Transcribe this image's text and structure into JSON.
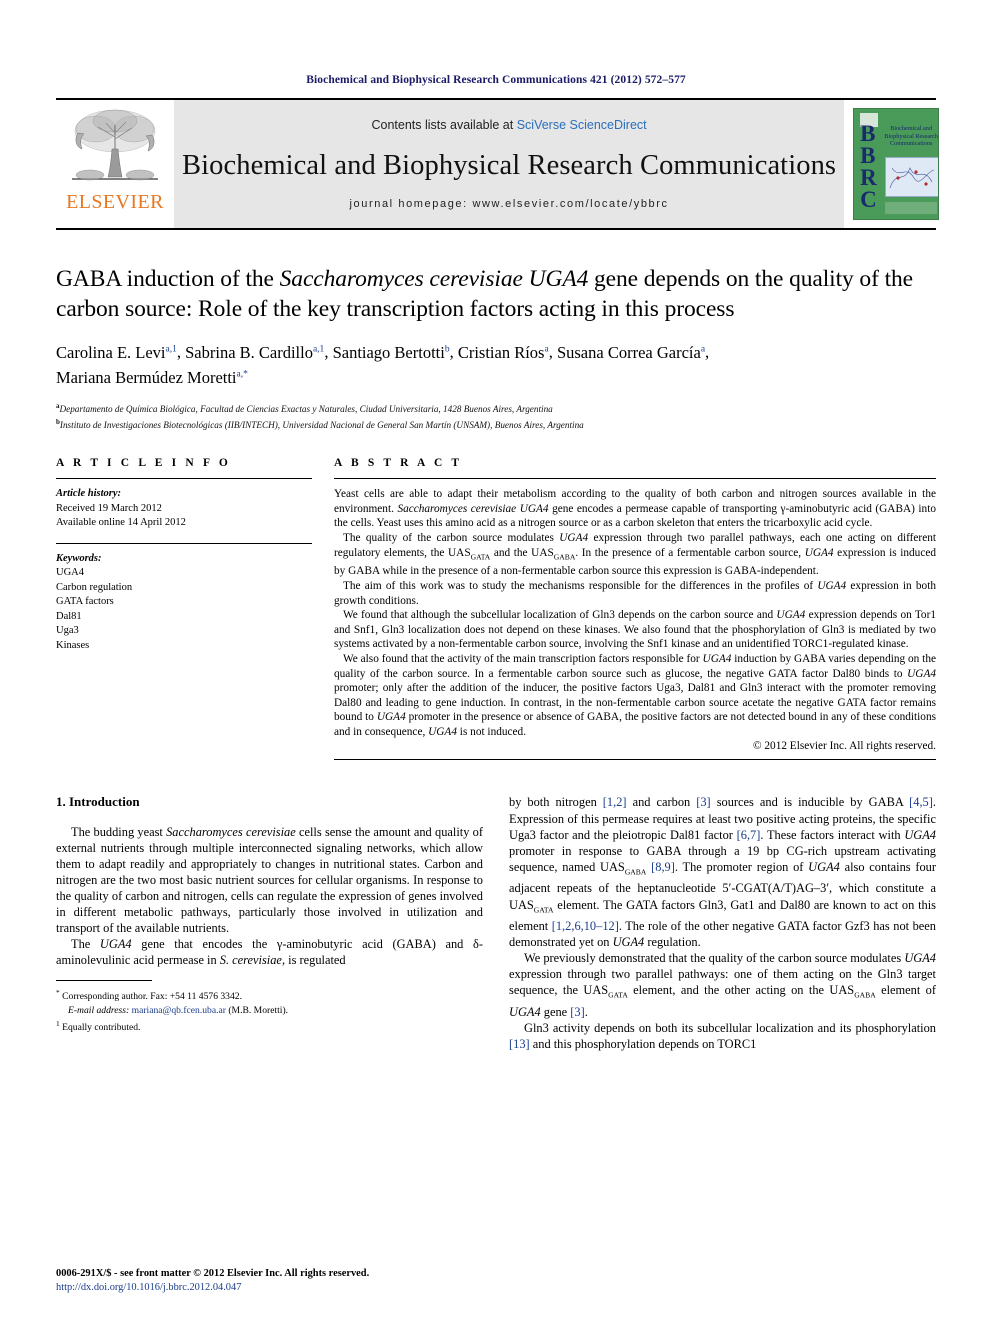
{
  "running_head": "Biochemical and Biophysical Research Communications 421 (2012) 572–577",
  "masthead": {
    "contents_prefix": "Contents lists available at ",
    "contents_link": "SciVerse ScienceDirect",
    "journal_title": "Biochemical and Biophysical Research Communications",
    "homepage": "journal homepage: www.elsevier.com/locate/ybbrc",
    "publisher_wordmark": "ELSEVIER",
    "cover": {
      "letters": "B\nB\nR\nC",
      "title": "Biochemical and Biophysical Research Communications"
    }
  },
  "article": {
    "title_line1": "GABA induction of the ",
    "title_italic1": "Saccharomyces cerevisiae UGA4",
    "title_line2": " gene depends on the quality of the carbon source: Role of the key transcription factors acting in this process",
    "authors": [
      {
        "name": "Carolina E. Levi",
        "marks": "a,1"
      },
      {
        "name": "Sabrina B. Cardillo",
        "marks": "a,1"
      },
      {
        "name": "Santiago Bertotti",
        "marks": "b"
      },
      {
        "name": "Cristian Ríos",
        "marks": "a"
      },
      {
        "name": "Susana Correa García",
        "marks": "a"
      },
      {
        "name": "Mariana Bermúdez Moretti",
        "marks": "a,*"
      }
    ],
    "affiliations": [
      {
        "mark": "a",
        "text": "Departamento de Química Biológica, Facultad de Ciencias Exactas y Naturales, Ciudad Universitaria, 1428 Buenos Aires, Argentina"
      },
      {
        "mark": "b",
        "text": "Instituto de Investigaciones Biotecnológicas (IIB/INTECH), Universidad Nacional de General San Martín (UNSAM), Buenos Aires, Argentina"
      }
    ]
  },
  "article_info": {
    "heading": "A R T I C L E   I N F O",
    "history_label": "Article history:",
    "history_lines": [
      "Received 19 March 2012",
      "Available online 14 April 2012"
    ],
    "keywords_label": "Keywords:",
    "keywords": [
      "UGA4",
      "Carbon regulation",
      "GATA factors",
      "Dal81",
      "Uga3",
      "Kinases"
    ]
  },
  "abstract": {
    "heading": "A B S T R A C T",
    "paragraphs": [
      "Yeast cells are able to adapt their metabolism according to the quality of both carbon and nitrogen sources available in the environment. Saccharomyces cerevisiae UGA4 gene encodes a permease capable of transporting γ-aminobutyric acid (GABA) into the cells. Yeast uses this amino acid as a nitrogen source or as a carbon skeleton that enters the tricarboxylic acid cycle.",
      "The quality of the carbon source modulates UGA4 expression through two parallel pathways, each one acting on different regulatory elements, the UASGATA and the UASGABA. In the presence of a fermentable carbon source, UGA4 expression is induced by GABA while in the presence of a non-fermentable carbon source this expression is GABA-independent.",
      "The aim of this work was to study the mechanisms responsible for the differences in the profiles of UGA4 expression in both growth conditions.",
      "We found that although the subcellular localization of Gln3 depends on the carbon source and UGA4 expression depends on Tor1 and Snf1, Gln3 localization does not depend on these kinases. We also found that the phosphorylation of Gln3 is mediated by two systems activated by a non-fermentable carbon source, involving the Snf1 kinase and an unidentified TORC1-regulated kinase.",
      "We also found that the activity of the main transcription factors responsible for UGA4 induction by GABA varies depending on the quality of the carbon source. In a fermentable carbon source such as glucose, the negative GATA factor Dal80 binds to UGA4 promoter; only after the addition of the inducer, the positive factors Uga3, Dal81 and Gln3 interact with the promoter removing Dal80 and leading to gene induction. In contrast, in the non-fermentable carbon source acetate the negative GATA factor remains bound to UGA4 promoter in the presence or absence of GABA, the positive factors are not detected bound in any of these conditions and in consequence, UGA4 is not induced."
    ],
    "copyright": "© 2012 Elsevier Inc. All rights reserved."
  },
  "body": {
    "section_title": "1. Introduction",
    "left_paragraphs": [
      "The budding yeast Saccharomyces cerevisiae cells sense the amount and quality of external nutrients through multiple interconnected signaling networks, which allow them to adapt readily and appropriately to changes in nutritional states. Carbon and nitrogen are the two most basic nutrient sources for cellular organisms. In response to the quality of carbon and nitrogen, cells can regulate the expression of genes involved in different metabolic pathways, particularly those involved in utilization and transport of the available nutrients.",
      "The UGA4 gene that encodes the γ-aminobutyric acid (GABA) and δ-aminolevulinic acid permease in S. cerevisiae, is regulated"
    ],
    "right_paragraphs": [
      "by both nitrogen [1,2] and carbon [3] sources and is inducible by GABA [4,5]. Expression of this permease requires at least two positive acting proteins, the specific Uga3 factor and the pleiotropic Dal81 factor [6,7]. These factors interact with UGA4 promoter in response to GABA through a 19 bp CG-rich upstream activating sequence, named UASGABA [8,9]. The promoter region of UGA4 also contains four adjacent repeats of the heptanucleotide 5′-CGAT(A/T)AG–3′, which constitute a UASGATA element. The GATA factors Gln3, Gat1 and Dal80 are known to act on this element [1,2,6,10–12]. The role of the other negative GATA factor Gzf3 has not been demonstrated yet on UGA4 regulation.",
      "We previously demonstrated that the quality of the carbon source modulates UGA4 expression through two parallel pathways: one of them acting on the Gln3 target sequence, the UASGATA element, and the other acting on the UASGABA element of UGA4 gene [3].",
      "Gln3 activity depends on both its subcellular localization and its phosphorylation [13] and this phosphorylation depends on TORC1"
    ]
  },
  "footnotes": {
    "corresponding": "Corresponding author. Fax: +54 11 4576 3342.",
    "email_label": "E-mail address:",
    "email": "mariana@qb.fcen.uba.ar",
    "email_suffix": "(M.B. Moretti).",
    "equal_contrib": "Equally contributed."
  },
  "footer": {
    "issn_line": "0006-291X/$ - see front matter © 2012 Elsevier Inc. All rights reserved.",
    "doi_line": "http://dx.doi.org/10.1016/j.bbrc.2012.04.047"
  },
  "colors": {
    "running_head": "#1a1a66",
    "link": "#2a6ebb",
    "reference": "#1a3c8c",
    "elsevier_orange": "#e87722",
    "cover_green": "#4a9a5a"
  }
}
